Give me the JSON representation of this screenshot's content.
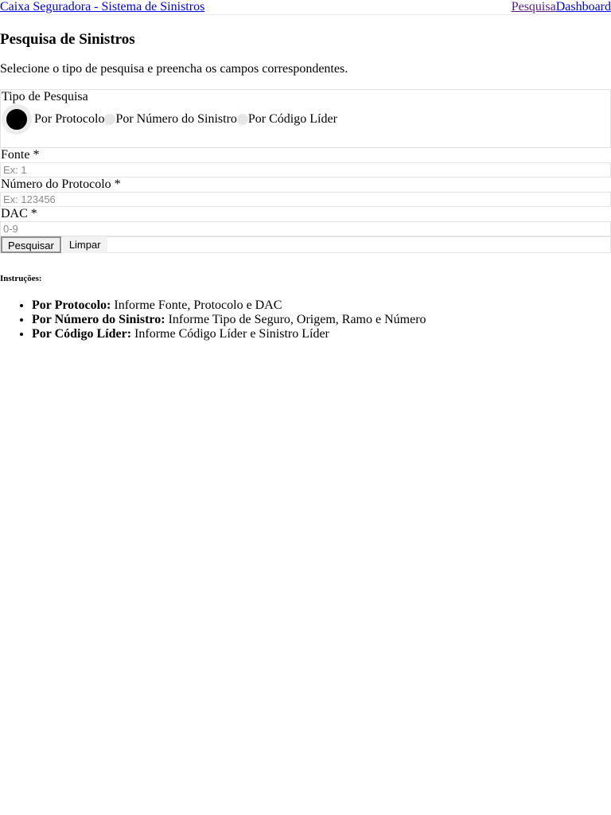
{
  "header": {
    "brand": "Caixa Seguradora - Sistema de Sinistros",
    "nav": [
      {
        "label": "Pesquisa"
      },
      {
        "label": "Dashboard"
      }
    ]
  },
  "page": {
    "title": "Pesquisa de Sinistros",
    "description": "Selecione o tipo de pesquisa e preencha os campos correspondentes."
  },
  "search_type": {
    "legend": "Tipo de Pesquisa",
    "options": [
      {
        "label": "Por Protocolo",
        "selected": true
      },
      {
        "label": "Por Número do Sinistro",
        "selected": false
      },
      {
        "label": "Por Código Líder",
        "selected": false
      }
    ]
  },
  "fields": {
    "fonte": {
      "label": "Fonte *",
      "placeholder": "Ex: 1",
      "value": ""
    },
    "protocolo": {
      "label": "Número do Protocolo *",
      "placeholder": "Ex: 123456",
      "value": ""
    },
    "dac": {
      "label": "DAC *",
      "placeholder": "0-9",
      "value": ""
    }
  },
  "actions": {
    "search_label": "Pesquisar",
    "clear_label": "Limpar"
  },
  "instructions": {
    "title": "Instruções:",
    "items": [
      {
        "term": "Por Protocolo:",
        "text": " Informe Fonte, Protocolo e DAC"
      },
      {
        "term": "Por Número do Sinistro:",
        "text": " Informe Tipo de Seguro, Origem, Ramo e Número"
      },
      {
        "term": "Por Código Líder:",
        "text": " Informe Código Líder e Sinistro Líder"
      }
    ]
  }
}
